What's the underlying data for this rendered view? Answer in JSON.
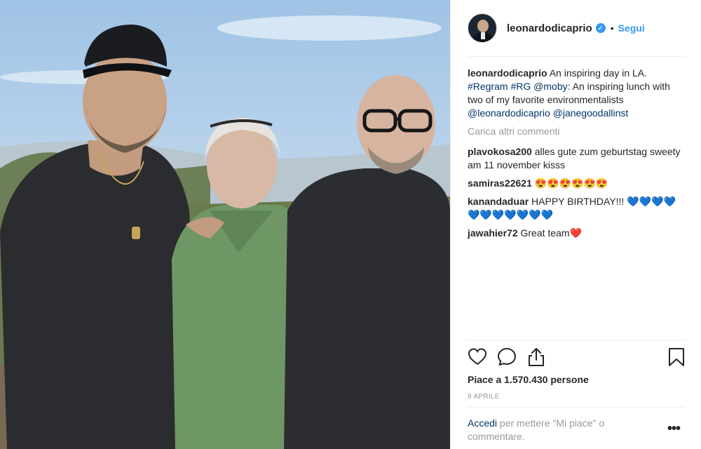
{
  "post": {
    "username": "leonardodicaprio",
    "verified_mark": "✓",
    "separator": "•",
    "follow_label": "Segui",
    "caption": {
      "username": "leonardodicaprio",
      "text_1": "An inspiring day in LA.",
      "tag_regram": "#Regram",
      "tag_rg": "#RG",
      "tag_moby": "@moby",
      "text_2": ": An inspiring lunch with two of my favorite environmentalists",
      "tag_leo": "@leonardodicaprio",
      "tag_jane": "@janegoodallinst"
    },
    "load_more": "Carica altri commenti",
    "comments": [
      {
        "username": "plavokosa200",
        "text": "alles gute zum geburtstag sweety am 11 november kisss"
      },
      {
        "username": "samiras22621",
        "text": "😍😍😍😍😍😍"
      },
      {
        "username": "kanandaduar",
        "text": "HAPPY BIRTHDAY!!!",
        "hearts": "💙💙💙💙💙💙💙💙💙💙💙"
      },
      {
        "username": "jawahier72",
        "text": "Great team",
        "heart": "❤️"
      }
    ],
    "likes": "Piace a 1.570.430 persone",
    "date": "9 APRILE",
    "login_link": "Accedi",
    "login_text": "per mettere \"Mi piace\" o commentare.",
    "more_menu": "•••"
  },
  "icons": {
    "like": "heart-outline-icon",
    "comment": "speech-bubble-icon",
    "share": "share-upload-icon",
    "save": "bookmark-icon"
  },
  "colors": {
    "link_blue": "#3897f0",
    "tag_navy": "#003569",
    "muted": "#999999",
    "text": "#262626"
  }
}
